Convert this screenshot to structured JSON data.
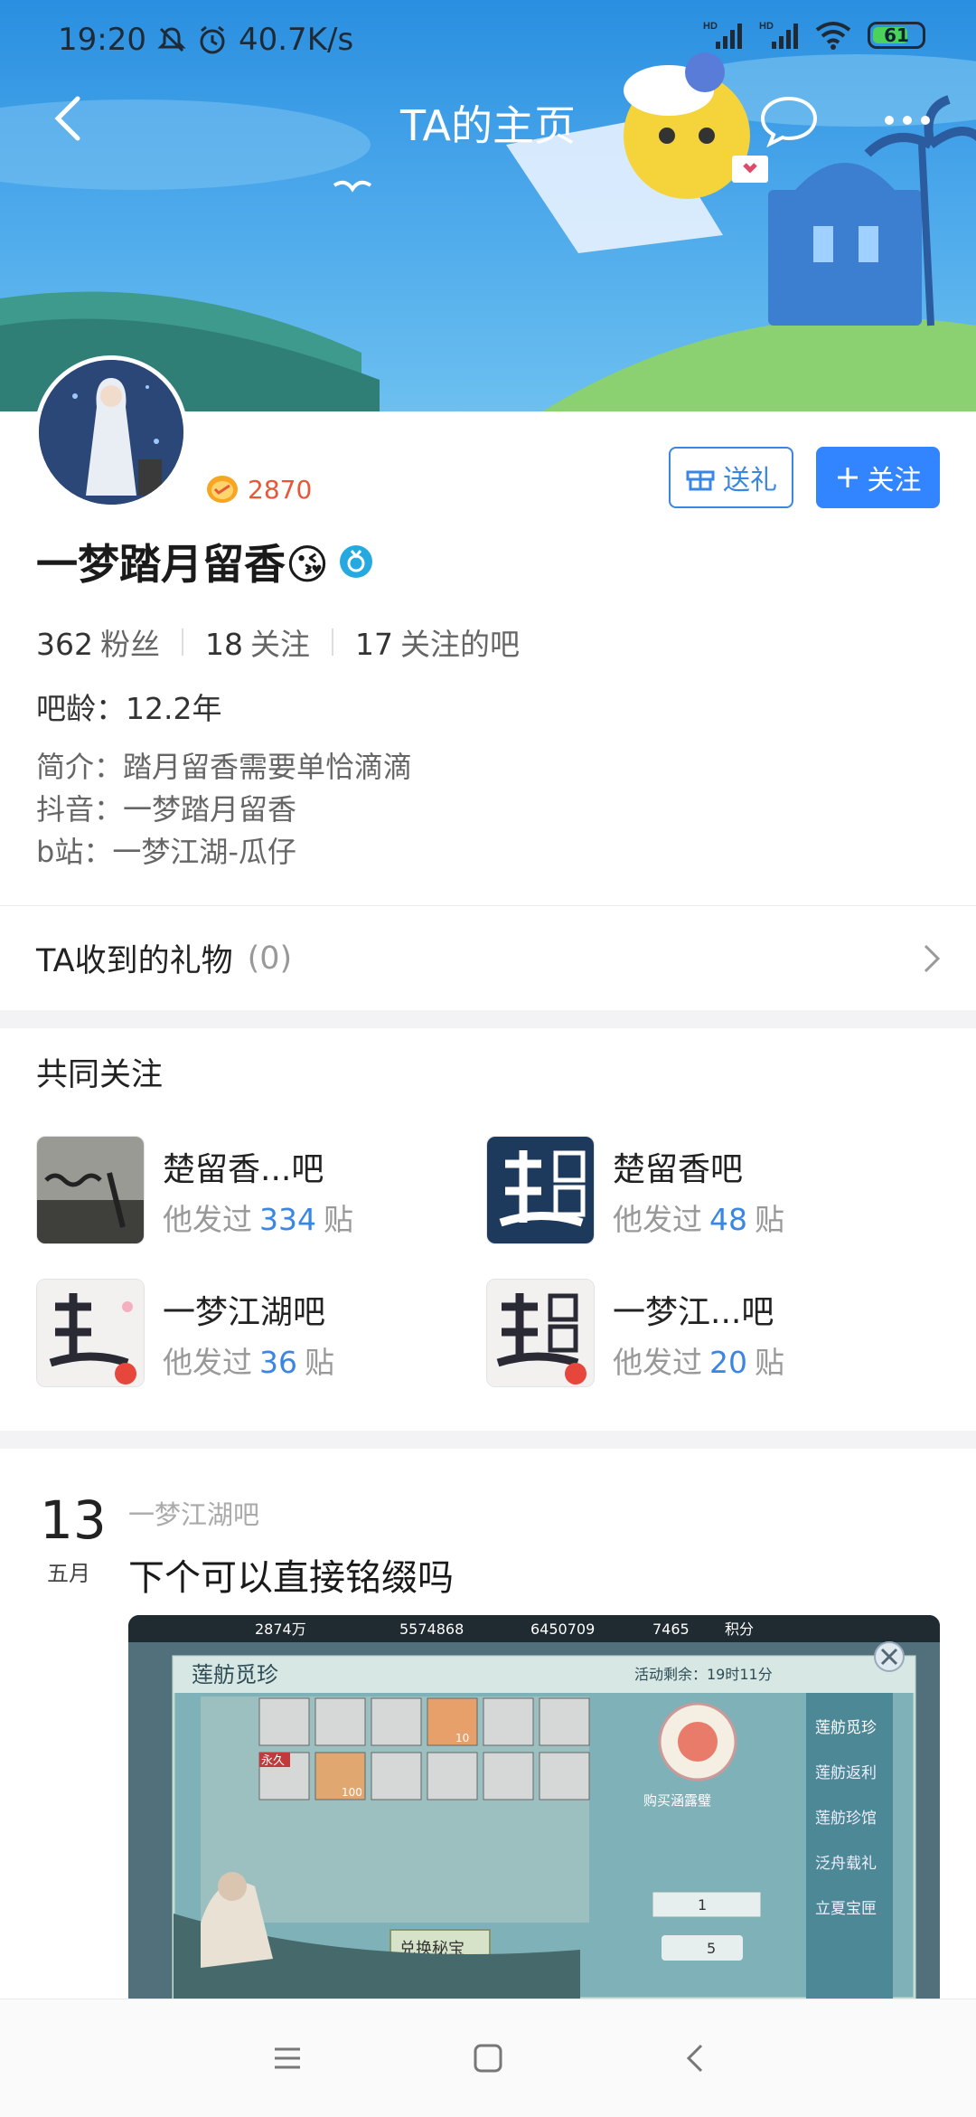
{
  "status_bar": {
    "time": "19:20",
    "speed": "40.7K/s",
    "battery": "61",
    "signal1": "HD",
    "signal2": "HD"
  },
  "nav": {
    "title": "TA的主页"
  },
  "profile": {
    "level": "2870",
    "username": "一梦踏月留香😘",
    "gift_button": "送礼",
    "follow_button": "关注",
    "fans_count": "362",
    "fans_label": "粉丝",
    "following_count": "18",
    "following_label": "关注",
    "forums_count": "17",
    "forums_label": "关注的吧",
    "age": "吧龄：12.2年",
    "bio": [
      "简介：踏月留香需要单恰滴滴",
      "抖音：一梦踏月留香",
      "b站：一梦江湖-瓜仔"
    ]
  },
  "gifts": {
    "label": "TA收到的礼物",
    "count": "(0)"
  },
  "common_follow": {
    "title": "共同关注",
    "prefix": "他发过",
    "suffix": "贴",
    "forums": [
      {
        "name": "楚留香...吧",
        "posts": "334"
      },
      {
        "name": "楚留香吧",
        "posts": "48"
      },
      {
        "name": "一梦江湖吧",
        "posts": "36"
      },
      {
        "name": "一梦江...吧",
        "posts": "20"
      }
    ]
  },
  "post": {
    "day": "13",
    "month": "五月",
    "forum": "一梦江湖吧",
    "title": "下个可以直接铭缀吗",
    "game": {
      "res1": "2874万",
      "res2": "5574868",
      "res3": "6450709",
      "res4": "7465",
      "res5": "积分",
      "panel_title": "莲舫觅珍",
      "timer": "活动剩余：19时11分",
      "tabs": [
        "莲舫觅珍",
        "莲舫返利",
        "莲舫珍馆",
        "泛舟载礼",
        "立夏宝匣"
      ],
      "buy_label": "购买涵露璧",
      "qty": "1",
      "cost": "5",
      "exchange": "兑换秘宝",
      "perm": "永久",
      "counts": [
        "10",
        "100"
      ]
    }
  }
}
